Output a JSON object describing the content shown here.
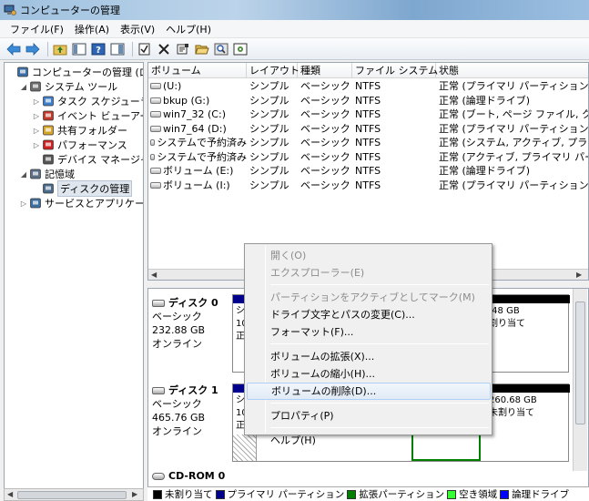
{
  "window": {
    "title": "コンピューターの管理"
  },
  "menubar": [
    "ファイル(F)",
    "操作(A)",
    "表示(V)",
    "ヘルプ(H)"
  ],
  "toolbar_icons": [
    "back-arrow-icon",
    "forward-arrow-icon",
    "folder-up-icon",
    "show-hide-tree-icon",
    "help-icon",
    "details-view-icon",
    "check-icon",
    "delete-x-icon",
    "properties-icon",
    "open-folder-icon",
    "search-icon",
    "settings-icon"
  ],
  "tree": [
    {
      "label": "コンピューターの管理 (ローカ",
      "indent": 0,
      "exp": "",
      "icon": "computer-icon"
    },
    {
      "label": "システム ツール",
      "indent": 1,
      "exp": "◢",
      "icon": "tools-icon"
    },
    {
      "label": "タスク スケジューラ",
      "indent": 2,
      "exp": "▷",
      "icon": "clock-icon"
    },
    {
      "label": "イベント ビューアー",
      "indent": 2,
      "exp": "▷",
      "icon": "event-log-icon"
    },
    {
      "label": "共有フォルダー",
      "indent": 2,
      "exp": "▷",
      "icon": "shared-folder-icon"
    },
    {
      "label": "パフォーマンス",
      "indent": 2,
      "exp": "▷",
      "icon": "performance-icon"
    },
    {
      "label": "デバイス マネージャー",
      "indent": 2,
      "exp": "",
      "icon": "device-manager-icon"
    },
    {
      "label": "記憶域",
      "indent": 1,
      "exp": "◢",
      "icon": "storage-icon"
    },
    {
      "label": "ディスクの管理",
      "indent": 2,
      "exp": "",
      "icon": "disk-management-icon",
      "selected": true
    },
    {
      "label": "サービスとアプリケーショ",
      "indent": 1,
      "exp": "▷",
      "icon": "services-icon"
    }
  ],
  "volumes": {
    "columns": [
      "ボリューム",
      "レイアウト",
      "種類",
      "ファイル システム",
      "状態"
    ],
    "rows": [
      [
        "(U:)",
        "シンプル",
        "ベーシック",
        "NTFS",
        "正常 (プライマリ パーティション)"
      ],
      [
        "bkup (G:)",
        "シンプル",
        "ベーシック",
        "NTFS",
        "正常 (論理ドライブ)"
      ],
      [
        "win7_32 (C:)",
        "シンプル",
        "ベーシック",
        "NTFS",
        "正常 (ブート, ページ ファイル, クラ"
      ],
      [
        "win7_64 (D:)",
        "シンプル",
        "ベーシック",
        "NTFS",
        "正常 (プライマリ パーティション)"
      ],
      [
        "システムで予約済み",
        "シンプル",
        "ベーシック",
        "NTFS",
        "正常 (システム, アクティブ, プライマ"
      ],
      [
        "システムで予約済み",
        "シンプル",
        "ベーシック",
        "NTFS",
        "正常 (アクティブ, プライマリ パーテ"
      ],
      [
        "ボリューム (E:)",
        "シンプル",
        "ベーシック",
        "NTFS",
        "正常 (論理ドライブ)"
      ],
      [
        "ボリューム (I:)",
        "シンプル",
        "ベーシック",
        "NTFS",
        "正常 (プライマリ パーティション)"
      ]
    ]
  },
  "disks": [
    {
      "name": "ディスク 0",
      "type": "ベーシック",
      "size": "232.88 GB",
      "status": "オンライン",
      "visible_fragments": [
        "シ",
        "10",
        "正"
      ],
      "right_fragments": [
        ".48 GB",
        "割り当て"
      ]
    },
    {
      "name": "ディスク 1",
      "type": "ベーシック",
      "size": "465.76 GB",
      "status": "オンライン",
      "visible_fragments": [
        "シ",
        "10",
        "正"
      ],
      "right_fragments": [
        "260.68 GB",
        "未割り当て"
      ]
    },
    {
      "name": "CD-ROM 0"
    }
  ],
  "legend": [
    {
      "label": "未割り当て",
      "color": "#000000"
    },
    {
      "label": "プライマリ パーティション",
      "color": "#00008b"
    },
    {
      "label": "拡張パーティション",
      "color": "#007f00"
    },
    {
      "label": "空き領域",
      "color": "#33ff33"
    },
    {
      "label": "論理ドライブ",
      "color": "#0000ff"
    }
  ],
  "context_menu": [
    {
      "label": "開く(O)",
      "disabled": true
    },
    {
      "label": "エクスプローラー(E)",
      "disabled": true
    },
    {
      "sep": true
    },
    {
      "label": "パーティションをアクティブとしてマーク(M)",
      "disabled": true
    },
    {
      "label": "ドライブ文字とパスの変更(C)...",
      "disabled": false
    },
    {
      "label": "フォーマット(F)...",
      "disabled": false
    },
    {
      "sep": true
    },
    {
      "label": "ボリュームの拡張(X)...",
      "disabled": false
    },
    {
      "label": "ボリュームの縮小(H)...",
      "disabled": false
    },
    {
      "label": "ボリュームの削除(D)...",
      "disabled": false,
      "hover": true
    },
    {
      "sep": true
    },
    {
      "label": "プロパティ(P)",
      "disabled": false
    },
    {
      "sep": true
    },
    {
      "label": "ヘルプ(H)",
      "disabled": false
    }
  ]
}
